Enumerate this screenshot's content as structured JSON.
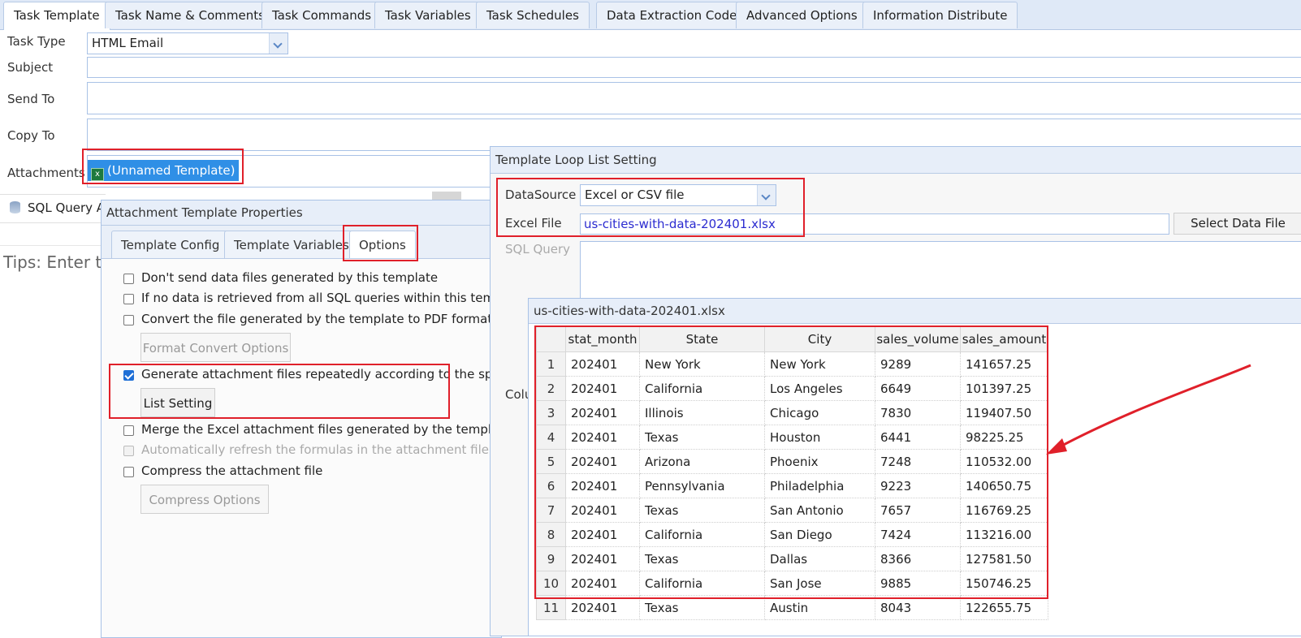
{
  "top_tabs": [
    "Task Template",
    "Task Name & Comments",
    "Task Commands",
    "Task Variables",
    "Task Schedules",
    "Data Extraction Code",
    "Advanced Options",
    "Information Distribute"
  ],
  "form": {
    "task_type_label": "Task Type",
    "task_type_value": "HTML Email",
    "subject_label": "Subject",
    "send_to_label": "Send To",
    "copy_to_label": "Copy To",
    "attachments_label": "Attachments",
    "attachment_item": "(Unnamed Template)",
    "sql_query_label": "SQL Query A",
    "tips_text": "Tips: Enter th"
  },
  "attach_props": {
    "title": "Attachment Template Properties",
    "tabs": [
      "Template Config",
      "Template Variables",
      "Options"
    ],
    "options": [
      {
        "label": "Don't send data files generated by this template",
        "checked": false,
        "disabled": false
      },
      {
        "label": "If no data is retrieved from all SQL queries within this templ",
        "checked": false,
        "disabled": false
      },
      {
        "label": "Convert the file generated by the template to PDF format(o",
        "checked": false,
        "disabled": false
      },
      {
        "label": "Generate attachment files repeatedly according to the speci",
        "checked": true,
        "disabled": false
      },
      {
        "label": "Merge the Excel attachment files generated by the template",
        "checked": false,
        "disabled": false
      },
      {
        "label": "Automatically refresh the formulas in the attachment file aft",
        "checked": false,
        "disabled": true
      },
      {
        "label": "Compress the attachment file",
        "checked": false,
        "disabled": false
      }
    ],
    "format_convert_button": "Format Convert Options",
    "list_setting_button": "List Setting",
    "compress_options_button": "Compress Options"
  },
  "loop_setting": {
    "title": "Template Loop List Setting",
    "datasource_label": "DataSource",
    "datasource_value": "Excel or CSV file",
    "excel_file_label": "Excel File",
    "excel_file_value": "us-cities-with-data-202401.xlsx",
    "select_data_file_button": "Select Data File",
    "sql_query_label": "SQL Query",
    "columns_label_partial": "Colu"
  },
  "preview": {
    "title": "us-cities-with-data-202401.xlsx",
    "columns": [
      "stat_month",
      "State",
      "City",
      "sales_volume",
      "sales_amount"
    ],
    "rows": [
      [
        "1",
        "202401",
        "New York",
        "New York",
        "9289",
        "141657.25"
      ],
      [
        "2",
        "202401",
        "California",
        "Los Angeles",
        "6649",
        "101397.25"
      ],
      [
        "3",
        "202401",
        "Illinois",
        "Chicago",
        "7830",
        "119407.50"
      ],
      [
        "4",
        "202401",
        "Texas",
        "Houston",
        "6441",
        "98225.25"
      ],
      [
        "5",
        "202401",
        "Arizona",
        "Phoenix",
        "7248",
        "110532.00"
      ],
      [
        "6",
        "202401",
        "Pennsylvania",
        "Philadelphia",
        "9223",
        "140650.75"
      ],
      [
        "7",
        "202401",
        "Texas",
        "San Antonio",
        "7657",
        "116769.25"
      ],
      [
        "8",
        "202401",
        "California",
        "San Diego",
        "7424",
        "113216.00"
      ],
      [
        "9",
        "202401",
        "Texas",
        "Dallas",
        "8366",
        "127581.50"
      ],
      [
        "10",
        "202401",
        "California",
        "San Jose",
        "9885",
        "150746.25"
      ],
      [
        "11",
        "202401",
        "Texas",
        "Austin",
        "8043",
        "122655.75"
      ]
    ]
  },
  "colors": {
    "highlight": "#e0202a",
    "accent": "#2f8fe6"
  }
}
